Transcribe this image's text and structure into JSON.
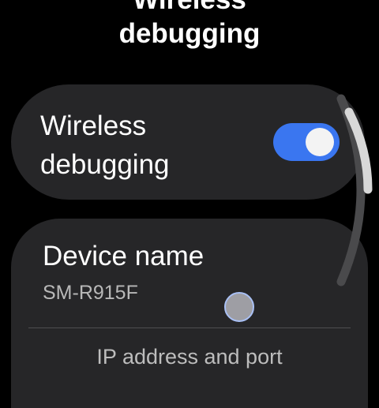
{
  "header": {
    "title_line1": "Wireless",
    "title_line2": "debugging"
  },
  "wireless_toggle": {
    "label_line1": "Wireless",
    "label_line2": "debugging",
    "on": true,
    "accent": "#3a76f0"
  },
  "device": {
    "label": "Device name",
    "value": "SM-R915F"
  },
  "ip": {
    "label": "IP address and port"
  }
}
